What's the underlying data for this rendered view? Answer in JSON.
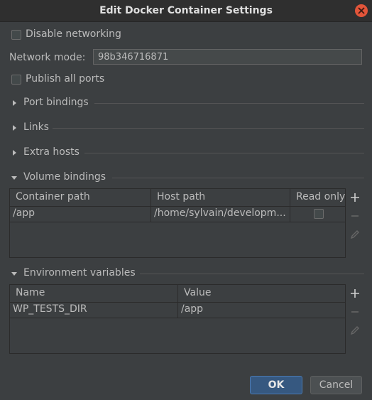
{
  "dialog": {
    "title": "Edit Docker Container Settings"
  },
  "disable_networking": {
    "label": "Disable networking",
    "checked": false
  },
  "network_mode": {
    "label": "Network mode:",
    "value": "98b346716871"
  },
  "publish_all_ports": {
    "label": "Publish all ports",
    "checked": false
  },
  "sections": {
    "port_bindings": "Port bindings",
    "links": "Links",
    "extra_hosts": "Extra hosts",
    "volume_bindings": "Volume bindings",
    "environment_variables": "Environment variables"
  },
  "volume_table": {
    "columns": [
      "Container path",
      "Host path",
      "Read only"
    ],
    "rows": [
      {
        "container_path": "/app",
        "host_path": "/home/sylvain/developm...",
        "read_only": false
      }
    ]
  },
  "env_table": {
    "columns": [
      "Name",
      "Value"
    ],
    "rows": [
      {
        "name": "WP_TESTS_DIR",
        "value": "/app"
      }
    ]
  },
  "toolbar_icons": [
    "plus-icon",
    "minus-icon",
    "pencil-icon"
  ],
  "buttons": {
    "ok": "OK",
    "cancel": "Cancel"
  },
  "colors": {
    "ok_button": "#365880",
    "ok_border": "#4a7ab3",
    "background": "#3c3f41",
    "close_button": "#e2553a"
  }
}
